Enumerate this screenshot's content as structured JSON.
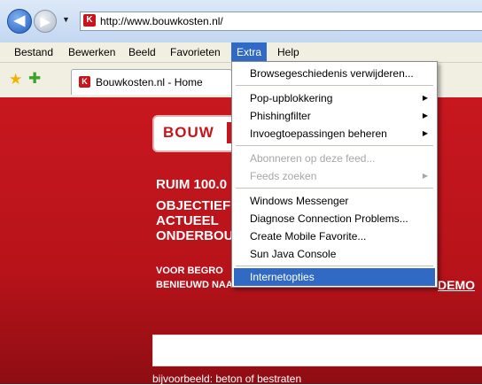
{
  "browser": {
    "address": "http://www.bouwkosten.nl/",
    "favicon_letter": "K",
    "back_glyph": "◀",
    "forward_glyph": "▶",
    "recent_glyph": "▼"
  },
  "menubar": {
    "items": [
      "Bestand",
      "Bewerken",
      "Beeld",
      "Favorieten",
      "Extra",
      "Help"
    ],
    "active": "Extra"
  },
  "tab": {
    "title": "Bouwkosten.nl - Home"
  },
  "page": {
    "logo_text": "BOUW",
    "headline1": "RUIM 100.0",
    "headline2_lines": [
      "OBJECTIEF",
      "ACTUEEL",
      "ONDERBOU"
    ],
    "subline1": "VOOR BEGRO",
    "subline2": "BENIEUWD NAAR DE MOGELIJKHEDEN? BEKIJK DE",
    "demo_link": "DEMO",
    "example": "bijvoorbeeld: beton of bestraten",
    "accent_color": "#c8141c"
  },
  "extra_menu": {
    "items": [
      {
        "label": "Browsegeschiedenis verwijderen...",
        "disabled": false,
        "submenu": false
      },
      {
        "label": "Pop-upblokkering",
        "disabled": false,
        "submenu": true
      },
      {
        "label": "Phishingfilter",
        "disabled": false,
        "submenu": true
      },
      {
        "label": "Invoegtoepassingen beheren",
        "disabled": false,
        "submenu": true
      },
      {
        "label": "Abonneren op deze feed...",
        "disabled": true,
        "submenu": false
      },
      {
        "label": "Feeds zoeken",
        "disabled": true,
        "submenu": true
      },
      {
        "label": "Windows Messenger",
        "disabled": false,
        "submenu": false
      },
      {
        "label": "Diagnose Connection Problems...",
        "disabled": false,
        "submenu": false
      },
      {
        "label": "Create Mobile Favorite...",
        "disabled": false,
        "submenu": false
      },
      {
        "label": "Sun Java Console",
        "disabled": false,
        "submenu": false
      },
      {
        "label": "Internetopties",
        "disabled": false,
        "submenu": false,
        "selected": true
      }
    ]
  }
}
